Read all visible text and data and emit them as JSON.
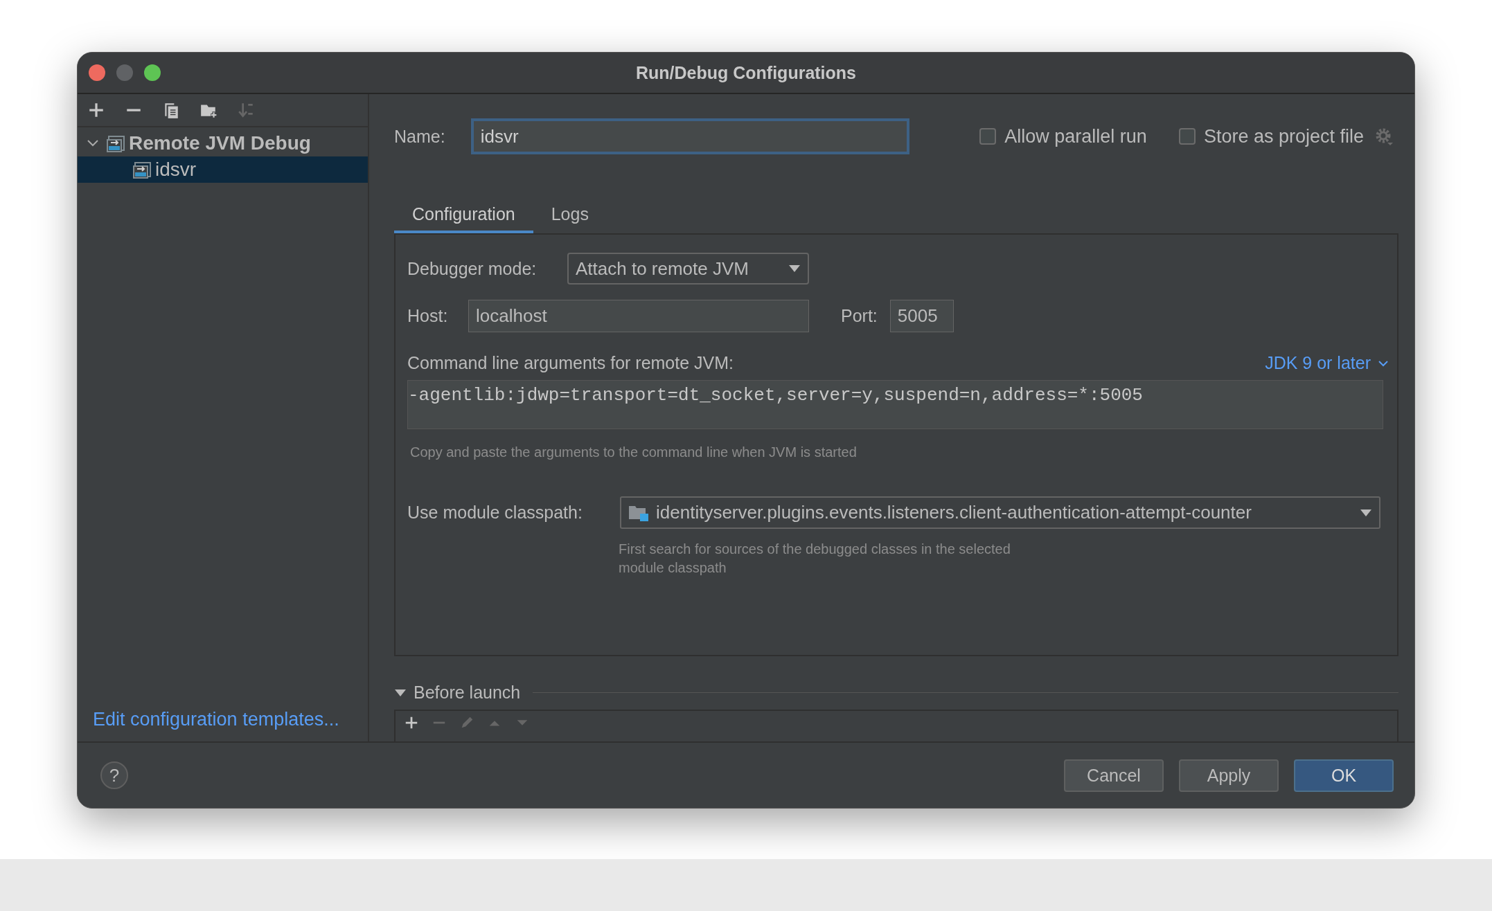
{
  "window": {
    "title": "Run/Debug Configurations"
  },
  "sidebar": {
    "toolbar": [
      {
        "kind": "add",
        "disabled": false
      },
      {
        "kind": "remove",
        "disabled": false
      },
      {
        "kind": "copy",
        "disabled": false
      },
      {
        "kind": "folder",
        "disabled": false
      },
      {
        "kind": "sort",
        "disabled": true
      }
    ],
    "tree": [
      {
        "label": "Remote JVM Debug",
        "expanded": true,
        "selected": false,
        "children": [
          {
            "label": "idsvr",
            "selected": true
          }
        ]
      }
    ],
    "edit_templates_link": "Edit configuration templates..."
  },
  "name": {
    "label": "Name:",
    "value": "idsvr",
    "focused": true
  },
  "checkboxes": [
    {
      "label": "Allow parallel run",
      "checked": false
    },
    {
      "label": "Store as project file",
      "checked": false
    }
  ],
  "tabs": [
    {
      "label": "Configuration",
      "selected": true
    },
    {
      "label": "Logs",
      "selected": false
    }
  ],
  "configuration": {
    "debugger_mode": {
      "label": "Debugger mode:",
      "value": "Attach to remote JVM"
    },
    "host": {
      "label": "Host:",
      "value": "localhost"
    },
    "port": {
      "label": "Port:",
      "value": "5005"
    },
    "command_line": {
      "label": "Command line arguments for remote JVM:",
      "jdk_link": "JDK 9 or later",
      "value": "-agentlib:jdwp=transport=dt_socket,server=y,suspend=n,address=*:5005",
      "hint": "Copy and paste the arguments to the command line when JVM is started"
    },
    "module_classpath": {
      "label": "Use module classpath:",
      "value": "identityserver.plugins.events.listeners.client-authentication-attempt-counter",
      "hint_lines": [
        "First search for sources of the debugged classes in the selected",
        "module classpath"
      ]
    }
  },
  "before_launch": {
    "label": "Before launch",
    "expanded": true,
    "toolbar": [
      {
        "kind": "add",
        "disabled": false
      },
      {
        "kind": "remove",
        "disabled": true
      },
      {
        "kind": "edit",
        "disabled": true
      },
      {
        "kind": "up",
        "disabled": true
      },
      {
        "kind": "down",
        "disabled": true
      }
    ]
  },
  "help_button": "?",
  "buttons": [
    {
      "label": "Cancel",
      "default": false
    },
    {
      "label": "Apply",
      "default": false
    },
    {
      "label": "OK",
      "default": true
    }
  ]
}
